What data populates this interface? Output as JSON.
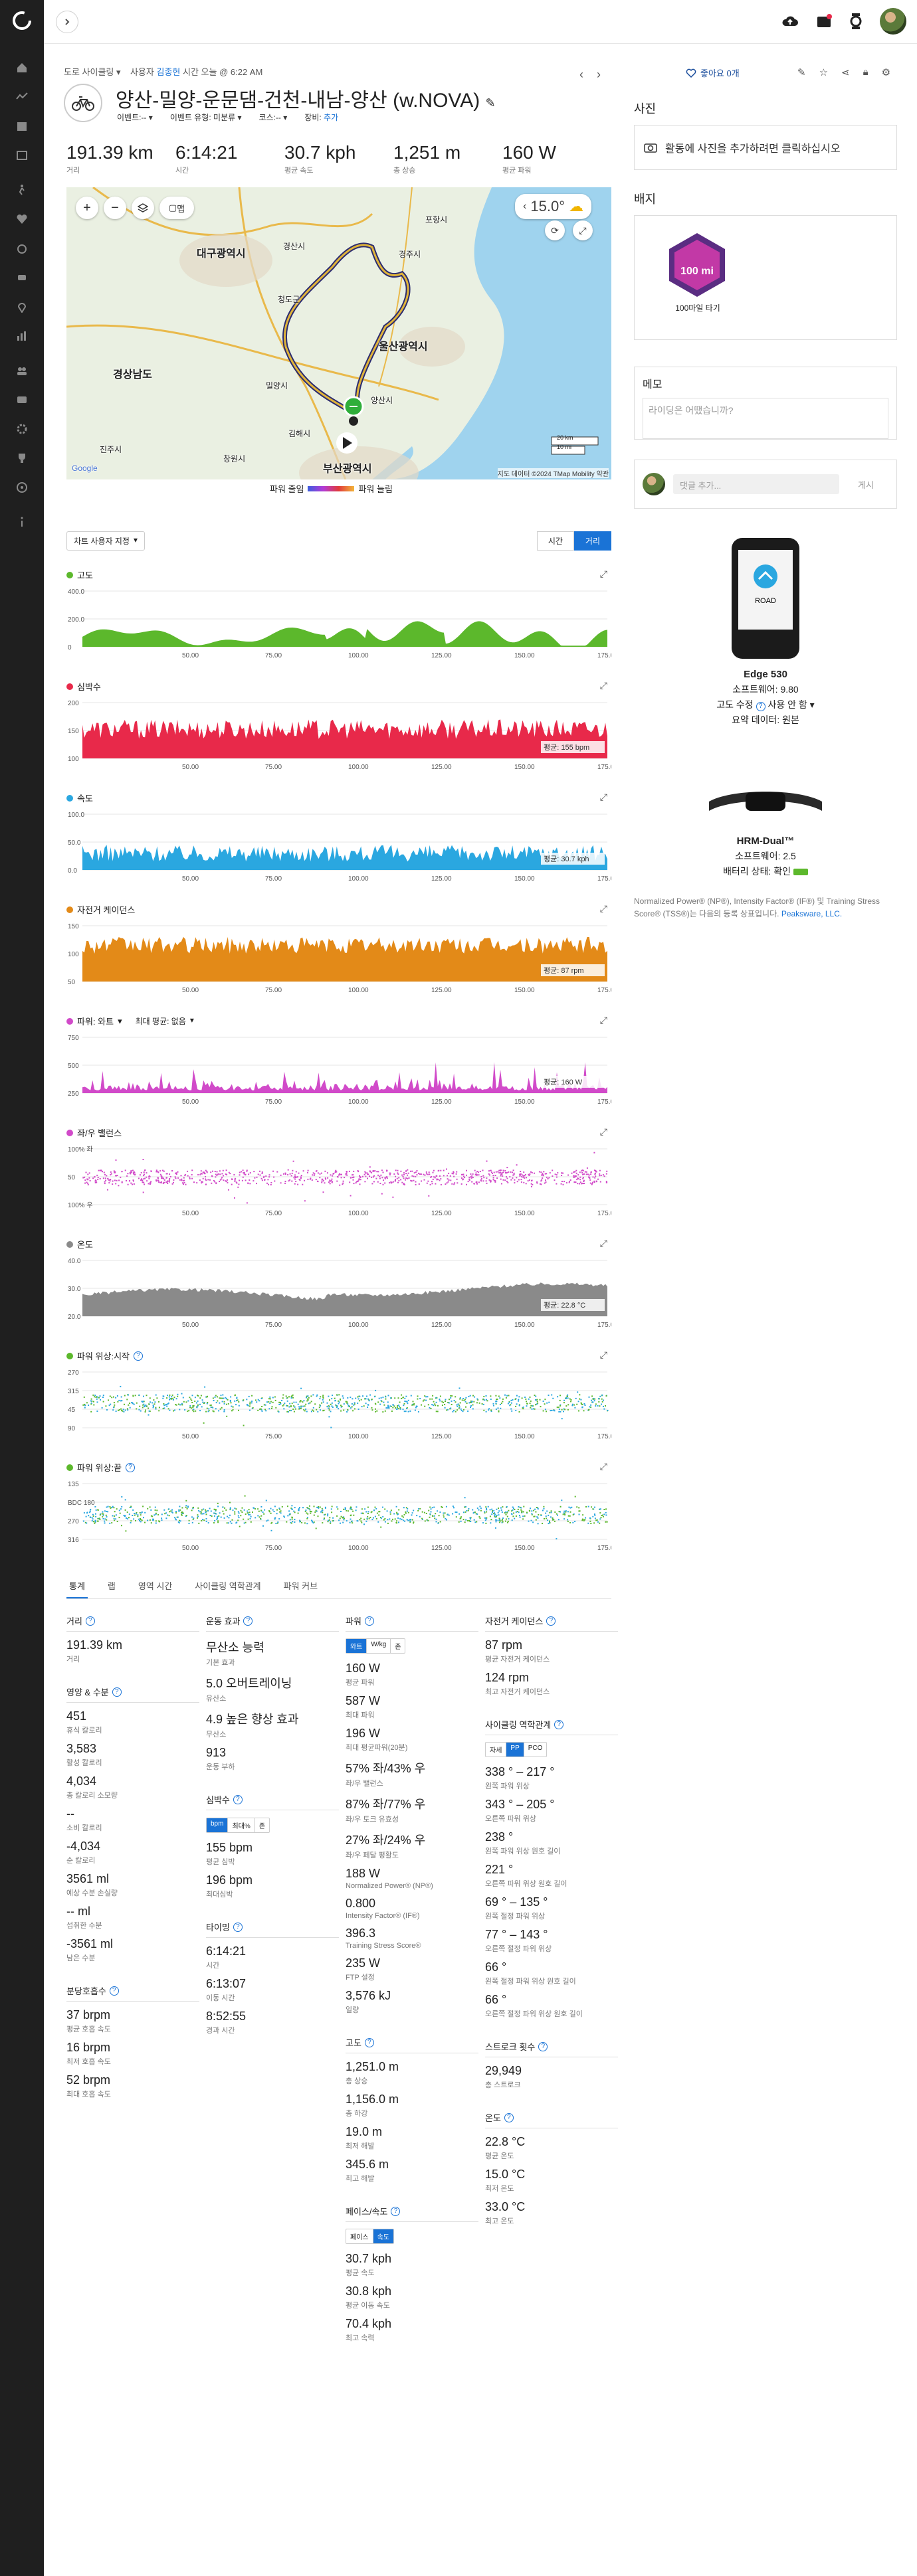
{
  "colors": {
    "accent": "#1a73d6",
    "elevation": "#5cb82c",
    "heart": "#e8294a",
    "speed": "#2aa7e0",
    "cadence": "#e38a18",
    "power": "#d14ac9",
    "lr_balance": "#d14ac9",
    "temperature": "#8a8a8a",
    "phase_left": "#5cb82c",
    "phase_right": "#2aa7e0"
  },
  "activity": {
    "breadcrumb": "도로 사이클링",
    "by_label": "사용자",
    "user": "김종현",
    "time_label": "시간",
    "time": "오늘 @ 6:22 AM",
    "title": "양산-밀양-운문댐-건천-내남-양산 (w.NOVA)",
    "event_label": "이벤트:--",
    "event_type": "이벤트 유형: 미분류",
    "course": "코스:--",
    "gear_label": "장비:",
    "gear_add": "추가",
    "like": "좋아요 0개"
  },
  "summary": [
    {
      "value": "191.39 km",
      "label": "거리"
    },
    {
      "value": "6:14:21",
      "label": "시간"
    },
    {
      "value": "30.7 kph",
      "label": "평균 속도"
    },
    {
      "value": "1,251 m",
      "label": "총 상승"
    },
    {
      "value": "160 W",
      "label": "평균 파워"
    }
  ],
  "map": {
    "weather": "15.0°",
    "labels": [
      "대구광역시",
      "경산시",
      "경주시",
      "울산광역시",
      "경상남도",
      "김해시",
      "부산광역시",
      "진주시",
      "창원시",
      "밀양시",
      "청도군",
      "양산시",
      "포항시"
    ],
    "view_toggle": "맵",
    "scale_km": "20 km",
    "scale_mi": "10 mi",
    "attribution": "지도 데이터 ©2024 TMap Mobility   약관",
    "google": "Google",
    "legend_low": "파워 줄임",
    "legend_high": "파워 늘림"
  },
  "controls": {
    "zoom_select": "차트 사용자 지정",
    "time_btn": "시간",
    "distance_btn": "거리"
  },
  "charts": [
    {
      "title": "고도",
      "color": "#5cb82c",
      "y_ticks": [
        "400.0",
        "200.0",
        "0"
      ],
      "x_ticks": [
        "50.00",
        "75.00",
        "100.00",
        "125.00",
        "150.00",
        "175.00"
      ],
      "badge": ""
    },
    {
      "title": "심박수",
      "color": "#e8294a",
      "y_ticks": [
        "200",
        "150",
        "100"
      ],
      "x_ticks": [
        "50.00",
        "75.00",
        "100.00",
        "125.00",
        "150.00",
        "175.00"
      ],
      "badge": "평균: 155 bpm"
    },
    {
      "title": "속도",
      "color": "#2aa7e0",
      "y_ticks": [
        "100.0",
        "50.0",
        "0.0"
      ],
      "x_ticks": [
        "50.00",
        "75.00",
        "100.00",
        "125.00",
        "150.00",
        "175.00"
      ],
      "badge": "평균: 30.7 kph"
    },
    {
      "title": "자전거 케이던스",
      "color": "#e38a18",
      "y_ticks": [
        "150",
        "100",
        "50"
      ],
      "x_ticks": [
        "50.00",
        "75.00",
        "100.00",
        "125.00",
        "150.00",
        "175.00"
      ],
      "badge": "평균: 87 rpm"
    },
    {
      "title": "파워: 와트",
      "color": "#d14ac9",
      "y_ticks": [
        "750",
        "500",
        "250"
      ],
      "x_ticks": [
        "50.00",
        "75.00",
        "100.00",
        "125.00",
        "150.00",
        "175.00"
      ],
      "badge": "평균: 160 W",
      "extra_select": "최대 평균: 없음"
    },
    {
      "title": "좌/우 밸런스",
      "color": "#d14ac9",
      "y_ticks": [
        "100% 좌",
        "50",
        "100% 우"
      ],
      "x_ticks": [
        "50.00",
        "75.00",
        "100.00",
        "125.00",
        "150.00",
        "175.00"
      ],
      "badge": ""
    },
    {
      "title": "온도",
      "color": "#8a8a8a",
      "y_ticks": [
        "40.0",
        "30.0",
        "20.0"
      ],
      "x_ticks": [
        "50.00",
        "75.00",
        "100.00",
        "125.00",
        "150.00",
        "175.00"
      ],
      "badge": "평균: 22.8 °C"
    },
    {
      "title": "파워 위상:시작",
      "color": "#5cb82c",
      "y_ticks": [
        "270",
        "315",
        "45",
        "90"
      ],
      "x_ticks": [
        "50.00",
        "75.00",
        "100.00",
        "125.00",
        "150.00",
        "175.00"
      ],
      "badge": ""
    },
    {
      "title": "파워 위상:끝",
      "color": "#5cb82c",
      "y_ticks": [
        "135",
        "BDC 180",
        "270",
        "316"
      ],
      "x_ticks": [
        "50.00",
        "75.00",
        "100.00",
        "125.00",
        "150.00",
        "175.00"
      ],
      "badge": ""
    }
  ],
  "tabs": [
    "통계",
    "랩",
    "영역 시간",
    "사이클링 역학관계",
    "파워 커브"
  ],
  "stats": {
    "col1": {
      "distance_title": "거리",
      "distance": [
        {
          "v": "191.39 km",
          "l": "거리"
        }
      ],
      "nutrition_title": "영양 & 수분",
      "nutrition": [
        {
          "v": "451",
          "l": "휴식 칼로리"
        },
        {
          "v": "3,583",
          "l": "활성 칼로리"
        },
        {
          "v": "4,034",
          "l": "총 칼로리 소모량"
        },
        {
          "v": "--",
          "l": "소비 칼로리"
        },
        {
          "v": "-4,034",
          "l": "순 칼로리"
        },
        {
          "v": "3561 ml",
          "l": "예상 수분 손실량"
        },
        {
          "v": "-- ml",
          "l": "섭취한 수분"
        },
        {
          "v": "-3561 ml",
          "l": "남은 수분"
        }
      ],
      "resp_title": "분당호흡수",
      "resp": [
        {
          "v": "37 brpm",
          "l": "평균 호흡 속도"
        },
        {
          "v": "16 brpm",
          "l": "최저 호흡 속도"
        },
        {
          "v": "52 brpm",
          "l": "최대 호흡 속도"
        }
      ]
    },
    "col2": {
      "effect_title": "운동 효과",
      "effect": [
        {
          "v": "무산소 능력",
          "l": "기본 효과"
        },
        {
          "v": "5.0 오버트레이닝",
          "l": "유산소"
        },
        {
          "v": "4.9 높은 향상 효과",
          "l": "무산소"
        },
        {
          "v": "913",
          "l": "운동 부하"
        }
      ],
      "hr_title": "심박수",
      "hr_seg": [
        "bpm",
        "최대%",
        "존"
      ],
      "hr": [
        {
          "v": "155 bpm",
          "l": "평균 심박"
        },
        {
          "v": "196 bpm",
          "l": "최대심박"
        }
      ],
      "timing_title": "타이밍",
      "timing": [
        {
          "v": "6:14:21",
          "l": "시간"
        },
        {
          "v": "6:13:07",
          "l": "이동 시간"
        },
        {
          "v": "8:52:55",
          "l": "경과 시간"
        }
      ]
    },
    "col3": {
      "power_title": "파워",
      "power_seg": [
        "와트",
        "W/kg",
        "존"
      ],
      "power": [
        {
          "v": "160 W",
          "l": "평균 파워"
        },
        {
          "v": "587 W",
          "l": "최대 파워"
        },
        {
          "v": "196 W",
          "l": "최대 평균파워(20분)"
        },
        {
          "v": "57% 좌/43% 우",
          "l": "좌/우 밸런스"
        },
        {
          "v": "87% 좌/77% 우",
          "l": "좌/우 토크 유효성"
        },
        {
          "v": "27% 좌/24% 우",
          "l": "좌/우 페달 평활도"
        },
        {
          "v": "188 W",
          "l": "Normalized Power® (NP®)"
        },
        {
          "v": "0.800",
          "l": "Intensity Factor® (IF®)"
        },
        {
          "v": "396.3",
          "l": "Training Stress Score®"
        },
        {
          "v": "235 W",
          "l": "FTP 설정"
        },
        {
          "v": "3,576 kJ",
          "l": "일량"
        }
      ],
      "elev_title": "고도",
      "elev": [
        {
          "v": "1,251.0 m",
          "l": "총 상승"
        },
        {
          "v": "1,156.0 m",
          "l": "총 하강"
        },
        {
          "v": "19.0 m",
          "l": "최저 해발"
        },
        {
          "v": "345.6 m",
          "l": "최고 해발"
        }
      ],
      "pace_title": "페이스/속도",
      "pace_seg": [
        "페이스",
        "속도"
      ],
      "pace": [
        {
          "v": "30.7 kph",
          "l": "평균 속도"
        },
        {
          "v": "30.8 kph",
          "l": "평균 이동 속도"
        },
        {
          "v": "70.4 kph",
          "l": "최고 속력"
        }
      ]
    },
    "col4": {
      "cad_title": "자전거 케이던스",
      "cad": [
        {
          "v": "87 rpm",
          "l": "평균 자전거 케이던스"
        },
        {
          "v": "124 rpm",
          "l": "최고 자전거 케이던스"
        }
      ],
      "dyn_title": "사이클링 역학관계",
      "dyn_seg": [
        "자세",
        "PP",
        "PCO"
      ],
      "dyn": [
        {
          "v": "338 ° – 217 °",
          "l": "왼쪽 파워 위상"
        },
        {
          "v": "343 ° – 205 °",
          "l": "오른쪽 파워 위상"
        },
        {
          "v": "238 °",
          "l": "왼쪽 파워 위상 원호 길이"
        },
        {
          "v": "221 °",
          "l": "오른쪽 파워 위상 원호 길이"
        },
        {
          "v": "69 ° – 135 °",
          "l": "왼쪽 절정 파워 위상"
        },
        {
          "v": "77 ° – 143 °",
          "l": "오른쪽 절정 파워 위상"
        },
        {
          "v": "66 °",
          "l": "왼쪽 절정 파워 위상 원호 길이"
        },
        {
          "v": "66 °",
          "l": "오른쪽 절정 파워 위상 원호 길이"
        }
      ],
      "stroke_title": "스트로크 횟수",
      "stroke": [
        {
          "v": "29,949",
          "l": "총 스트로크"
        }
      ],
      "temp_title": "온도",
      "temp": [
        {
          "v": "22.8 °C",
          "l": "평균 온도"
        },
        {
          "v": "15.0 °C",
          "l": "최저 온도"
        },
        {
          "v": "33.0 °C",
          "l": "최고 온도"
        }
      ]
    }
  },
  "right": {
    "photos_title": "사진",
    "photos_hint": "활동에 사진을 추가하려면 클릭하십시오",
    "badges_title": "배지",
    "badge_name": "100마일 타기",
    "badge_text": "100 mi",
    "memo_title": "메모",
    "memo_placeholder": "라이딩은 어땠습니까?",
    "comment_placeholder": "댓글 추가...",
    "comment_post": "게시",
    "device1": {
      "name": "Edge 530",
      "sw": "소프트웨어: 9.80",
      "elev": "고도 수정",
      "elev_value": "사용 안 함",
      "summary": "요약 데이터: 원본"
    },
    "device1_screen": "ROAD",
    "device2": {
      "name": "HRM-Dual™",
      "sw": "소프트웨어: 2.5",
      "battery": "배터리 상태: 확인"
    },
    "footnote": "Normalized Power® (NP®), Intensity Factor® (IF®) 및 Training Stress Score® (TSS®)는 다음의 등록 상표입니다.",
    "footnote_link": "Peaksware, LLC."
  }
}
